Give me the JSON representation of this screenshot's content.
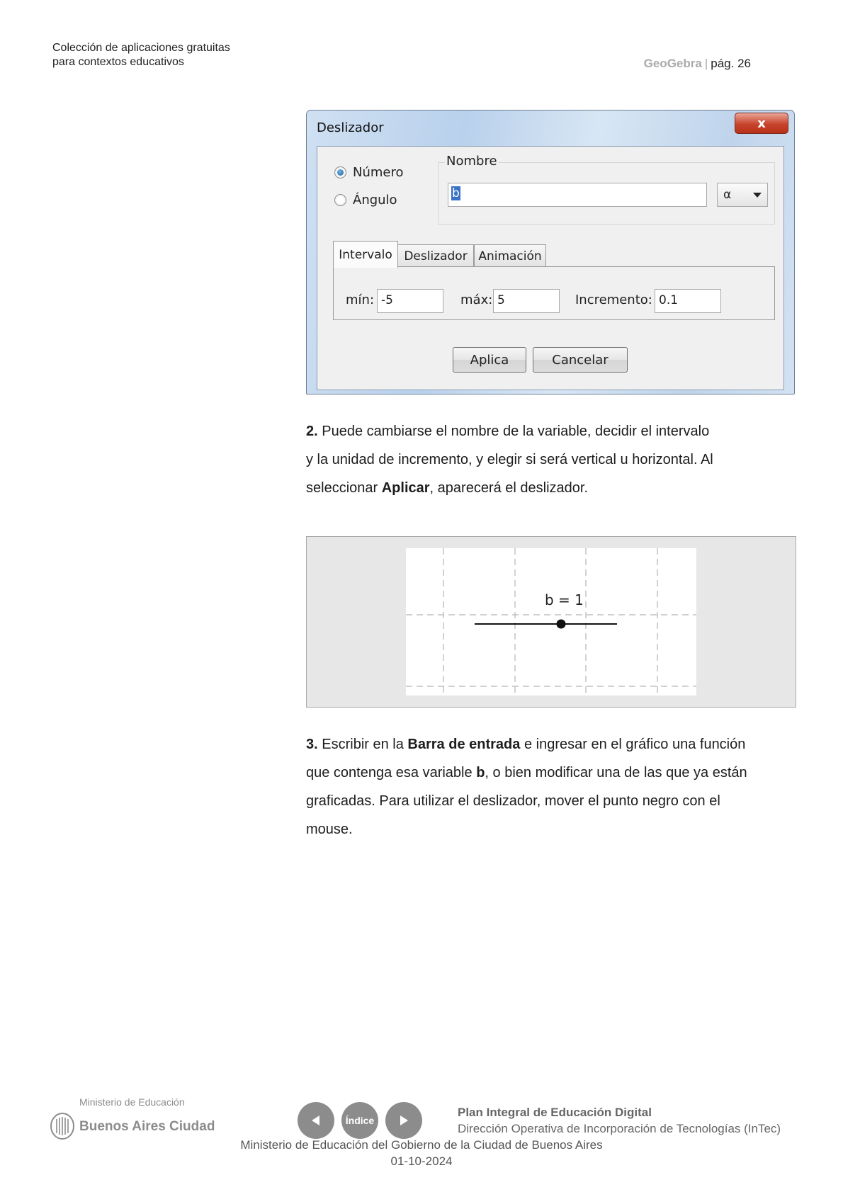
{
  "header": {
    "collection_line1": "Colección de aplicaciones gratuitas",
    "collection_line2": "para contextos educativos",
    "app_name": "GeoGebra",
    "separator": "|",
    "page_label": "pág. 26"
  },
  "dialog": {
    "title": "Deslizador",
    "close_glyph": "x",
    "radio_number": "Número",
    "radio_angle": "Ángulo",
    "name_legend": "Nombre",
    "name_value": "b",
    "greek_select": "α",
    "tabs": [
      "Intervalo",
      "Deslizador",
      "Animación"
    ],
    "min_label": "mín:",
    "min_value": "-5",
    "max_label": "máx:",
    "max_value": "5",
    "increment_label": "Incremento:",
    "increment_value": "0.1",
    "apply_button": "Aplica",
    "cancel_button": "Cancelar"
  },
  "step2": {
    "number": "2.",
    "text_a": "Puede cambiarse el nombre de la variable, decidir el intervalo",
    "text_b": "y la unidad de incremento, y elegir si será vertical u horizontal. Al",
    "text_c": "seleccionar",
    "bold": "Aplicar",
    "text_d": ", aparecerá el deslizador."
  },
  "slider_figure": {
    "label": "b = 1",
    "value": 1
  },
  "step3": {
    "number": "3.",
    "t1": "Escribir en la",
    "b1": "Barra de entrada",
    "t2": "e ingresar en el gráfico una función",
    "t3": "que contenga esa variable",
    "b2": "b",
    "t4": ", o bien modificar una de las que ya están",
    "t5": "graficadas. Para utilizar el deslizador, mover el punto negro con el",
    "t6": "mouse."
  },
  "footer": {
    "ministry_small": "Ministerio de Educación",
    "city": "Buenos Aires Ciudad",
    "index_label": "Índice",
    "plan": "Plan Integral de Educación Digital",
    "direction": "Dirección Operativa de Incorporación de Tecnologías (InTec)",
    "ministry_full": "Ministerio de Educación del Gobierno de la Ciudad de Buenos Aires",
    "date": "01-10-2024"
  }
}
